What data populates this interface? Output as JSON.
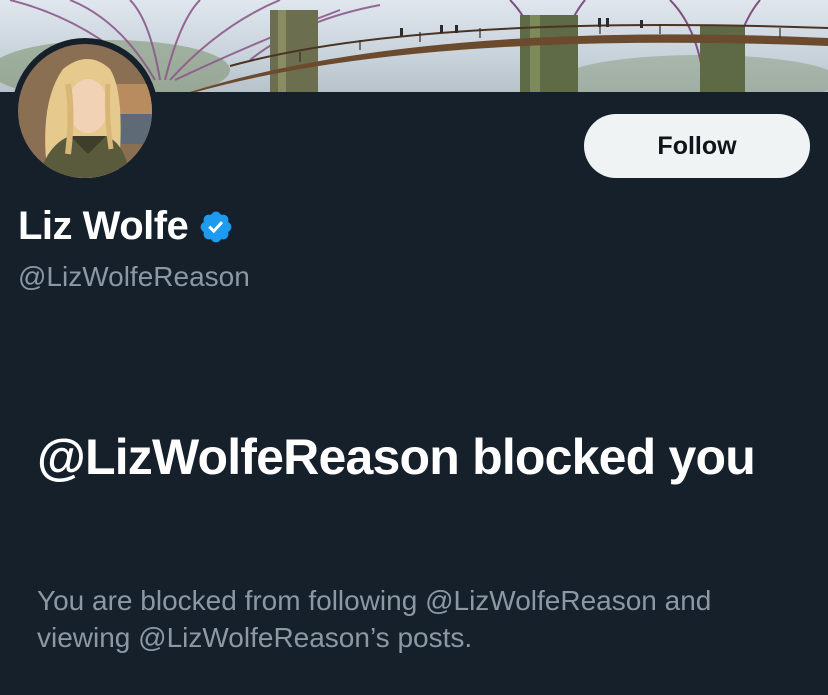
{
  "profile": {
    "display_name": "Liz Wolfe",
    "handle": "@LizWolfeReason",
    "verified": true,
    "verified_icon": "verified-badge-icon",
    "banner_icon": "banner-image",
    "avatar_icon": "profile-avatar"
  },
  "actions": {
    "follow_label": "Follow"
  },
  "blocked": {
    "title": "@LizWolfeReason blocked you",
    "description": "You are blocked from following @LizWolfeReason and viewing @LizWolfeReason’s posts."
  },
  "colors": {
    "background": "#15202b",
    "primary_text": "#ffffff",
    "secondary_text": "#8b98a5",
    "verified_blue": "#1d9bf0",
    "follow_button_bg": "#eff3f4",
    "follow_button_text": "#0f1419"
  }
}
